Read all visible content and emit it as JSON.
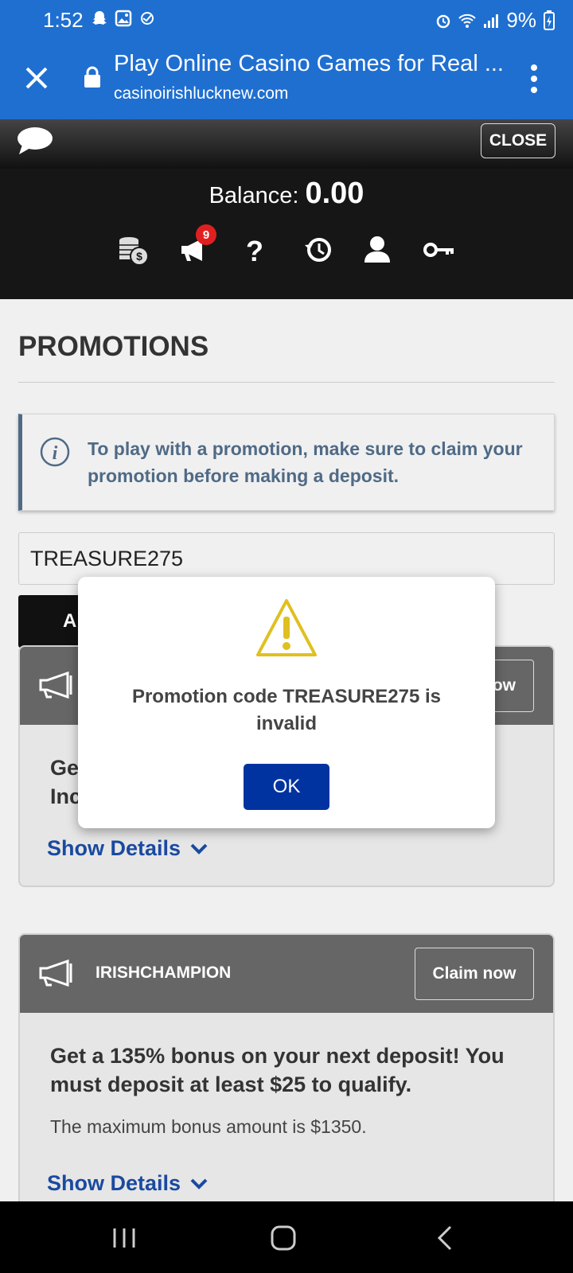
{
  "status_bar": {
    "time": "1:52",
    "battery_text": "9%",
    "icons": [
      "snapchat-icon",
      "gallery-icon",
      "sync-icon",
      "alarm-icon",
      "wifi-icon",
      "signal-icon",
      "battery-charging-icon"
    ]
  },
  "browser": {
    "title": "Play Online Casino Games for Real ...",
    "url": "casinoirishlucknew.com",
    "icons": [
      "close-icon",
      "lock-icon",
      "more-vert-icon"
    ]
  },
  "header": {
    "close_label": "CLOSE",
    "balance_label": "Balance:",
    "balance_value": "0.00",
    "notification_count": "9",
    "icons": [
      "chat-icon",
      "coins-icon",
      "megaphone-icon",
      "help-icon",
      "history-icon",
      "user-icon",
      "key-icon"
    ]
  },
  "promotions": {
    "title": "PROMOTIONS",
    "notice": "To play with a promotion, make sure to claim your promotion before making a deposit.",
    "code_value": "TREASURE275",
    "apply_label": "A",
    "cards": [
      {
        "name": "",
        "claim_label": "ow",
        "headline": "Ge\nInc",
        "description": "",
        "details_label": "Show Details"
      },
      {
        "name": "IRISHCHAMPION",
        "claim_label": "Claim now",
        "headline": "Get a 135% bonus on your next deposit! You must deposit at least $25 to qualify.",
        "description": "The maximum bonus amount is $1350.",
        "details_label": "Show Details"
      }
    ]
  },
  "modal": {
    "message": "Promotion code TREASURE275 is invalid",
    "ok_label": "OK",
    "icon": "warning-icon"
  },
  "navbar": {
    "icons": [
      "recent-apps-icon",
      "home-icon",
      "back-icon"
    ]
  },
  "colors": {
    "browser_bar": "#1f6fd0",
    "modal_button": "#0033a0",
    "link": "#1a4aa0",
    "badge": "#e02020",
    "notice_text": "#4f6a86"
  }
}
